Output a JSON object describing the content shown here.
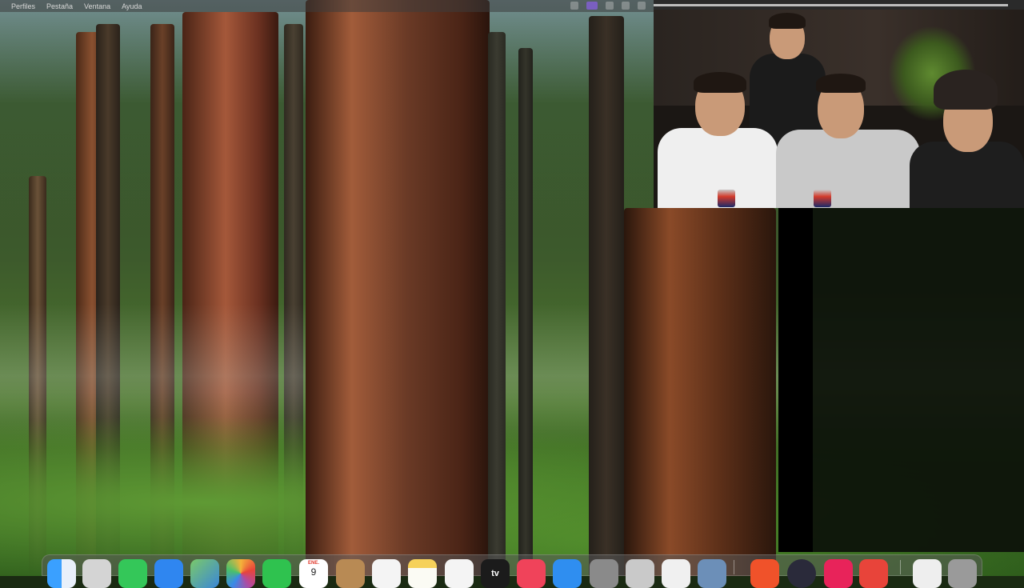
{
  "menubar": {
    "items": [
      "Perfiles",
      "Pestaña",
      "Ventana",
      "Ayuda"
    ]
  },
  "dock": {
    "calendar_month": "ENE.",
    "calendar_day": "9",
    "appletv_label": "tv",
    "apps": [
      {
        "name": "finder-icon",
        "color": "#3d8fe0"
      },
      {
        "name": "launchpad-icon",
        "color": "#d9d9d9"
      },
      {
        "name": "messages-icon",
        "color": "#34c759"
      },
      {
        "name": "mail-icon",
        "color": "#2f86f0"
      },
      {
        "name": "maps-icon",
        "color": "#5fb35a"
      },
      {
        "name": "photos-icon",
        "color": "#f5f5f5"
      },
      {
        "name": "facetime-icon",
        "color": "#2fc24f"
      },
      {
        "name": "calendar-icon",
        "color": "#ffffff"
      },
      {
        "name": "contacts-icon",
        "color": "#b88a54"
      },
      {
        "name": "reminders-icon",
        "color": "#f4f4f4"
      },
      {
        "name": "notes-icon",
        "color": "#f6d15a"
      },
      {
        "name": "freeform-icon",
        "color": "#f4f4f4"
      },
      {
        "name": "appletv-icon",
        "color": "#1b1b1b"
      },
      {
        "name": "music-icon",
        "color": "#f0435a"
      },
      {
        "name": "appstore-icon",
        "color": "#2f8ef0"
      },
      {
        "name": "system-settings-icon",
        "color": "#8a8a8a"
      },
      {
        "name": "iphone-mirroring-icon",
        "color": "#c9c9c9"
      },
      {
        "name": "textedit-icon",
        "color": "#f0f0f0"
      },
      {
        "name": "preview-icon",
        "color": "#6c8fb8"
      },
      {
        "name": "brave-icon",
        "color": "#f0522a"
      },
      {
        "name": "obs-icon",
        "color": "#2a2a3a"
      },
      {
        "name": "tiktok-icon",
        "color": "#e8235a"
      },
      {
        "name": "brave-beta-icon",
        "color": "#e8443a"
      },
      {
        "name": "downloads-stack-icon",
        "color": "#eeeeee"
      },
      {
        "name": "trash-icon",
        "color": "#9a9a9a"
      }
    ]
  }
}
